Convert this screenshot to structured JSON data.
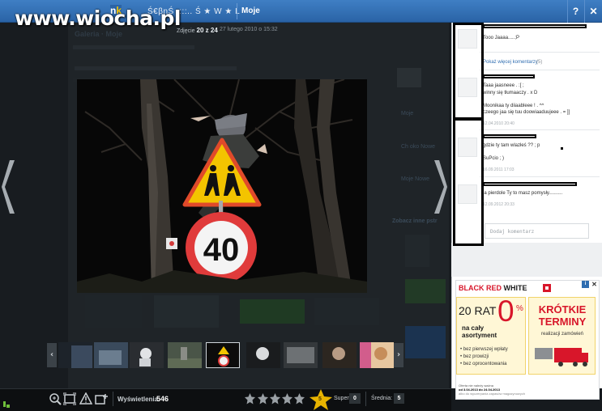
{
  "watermark": "www.wiocha.pl",
  "topbar": {
    "logo_n": "n",
    "logo_k": "k",
    "user_name": "Ś€βηŚ ::::.. Ś ★ W ★ L",
    "moje_label": "Moje",
    "help_label": "?",
    "close_label": "✕"
  },
  "background_page": {
    "gallery_label": "Galeria · Moje",
    "side_items": [
      "Moje",
      "Ch oko Nowe",
      "Moje Nowe",
      "Zobacz inne pstr"
    ]
  },
  "photo": {
    "counter_prefix": "Zdjęcie",
    "counter": "20 z 24",
    "date": "27 lutego 2010 o 15:32",
    "speed_limit": "40"
  },
  "bottombar": {
    "views_label": "Wyświetlenia:",
    "views_value": "546",
    "super_label": "Super",
    "super_value": "0",
    "srednia_label": "Średnia:",
    "srednia_value": "5",
    "star_label": "5"
  },
  "comments": {
    "first_text": "Tooo Jaaaa.....;P",
    "more_label": "Pokaż więcej komentarzy",
    "more_count": "(5)",
    "items": [
      {
        "lines": [
          "Taaa jaasneee . :[ ;",
          "winny się tłumaaczy . x D",
          "",
          "Moonikaa ty diiaableee ! . ^^",
          "czeego jaa się tuu doowiaaduujeee . = ]]"
        ],
        "date": "12.04.2010 20:40"
      },
      {
        "lines": [
          "gdzie ty tam wlazłeś ?? ; p",
          "",
          "SuPcio ; )"
        ],
        "date": "16.09.2011 17:03"
      },
      {
        "lines": [
          "ja pierdole Ty to masz pomysły.........."
        ],
        "date": "12.09.2012 20:33"
      }
    ],
    "input_placeholder": "Dodaj komentarz"
  },
  "ad": {
    "brand_part1": "BLACK RED",
    "brand_part2": " WHITE",
    "rat_text": "20 RAT",
    "zero": "0",
    "pct": "%",
    "na_caly": "na cały",
    "asortyment": "asortyment",
    "bullets": [
      "• bez pierwszej wpłaty",
      "• bez prowizji",
      "• bez oprocentowania"
    ],
    "krotkie": "KRÓTKIE",
    "terminy": "TERMINY",
    "realizacja": "realizacji zamówień",
    "fine1": "Oferta nie należy ważna",
    "fine2": "od 3.04.2013 do 24.04.2013",
    "fine3": "albo do wyczerpania zapasów magazynowych",
    "close_label": "✕",
    "info_label": "i"
  },
  "colors": {
    "topbar": "#3f7fc4",
    "ad_red": "#d8162a",
    "link_blue": "#2f6db0"
  }
}
